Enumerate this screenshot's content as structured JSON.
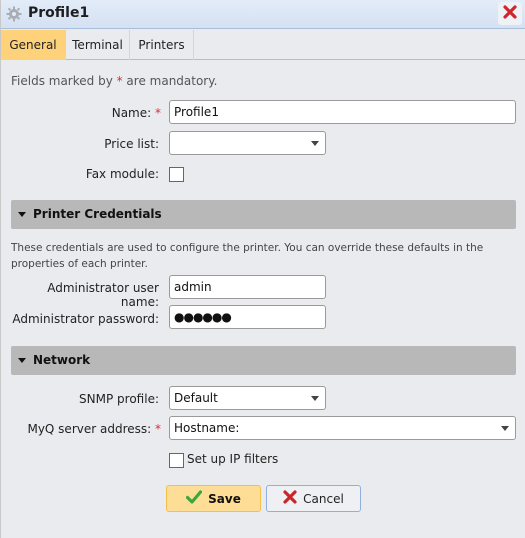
{
  "window": {
    "title": "Profile1",
    "title_icon": "gear-icon",
    "close_icon": "close-icon"
  },
  "tabs": [
    {
      "label": "General",
      "active": true
    },
    {
      "label": "Terminal",
      "active": false
    },
    {
      "label": "Printers",
      "active": false
    }
  ],
  "form": {
    "mandatory_prefix": "Fields marked by ",
    "mandatory_star": "*",
    "mandatory_suffix": " are mandatory.",
    "name_label": "Name:",
    "name_value": "Profile1",
    "price_list_label": "Price list:",
    "price_list_value": "",
    "fax_module_label": "Fax module:",
    "fax_module_checked": false,
    "required_star": "*"
  },
  "printer_credentials": {
    "title": "Printer Credentials",
    "note": "These credentials are used to configure the printer. You can override these defaults in the properties of each printer.",
    "admin_user_label": "Administrator user name:",
    "admin_user_value": "admin",
    "admin_password_label": "Administrator password:",
    "admin_password_value": "●●●●●●"
  },
  "network": {
    "title": "Network",
    "snmp_label": "SNMP profile:",
    "snmp_value": "Default",
    "server_label": "MyQ server address:",
    "server_value": "Hostname:",
    "ip_filters_label": "Set up IP filters",
    "ip_filters_checked": false
  },
  "buttons": {
    "save": "Save",
    "save_icon": "checkmark-icon",
    "cancel": "Cancel",
    "cancel_icon": "close-icon"
  },
  "colors": {
    "active_tab": "#fdd27b",
    "required_star": "#cc3333",
    "save_button": "#fedd96",
    "section_header": "#b8b8b8"
  }
}
